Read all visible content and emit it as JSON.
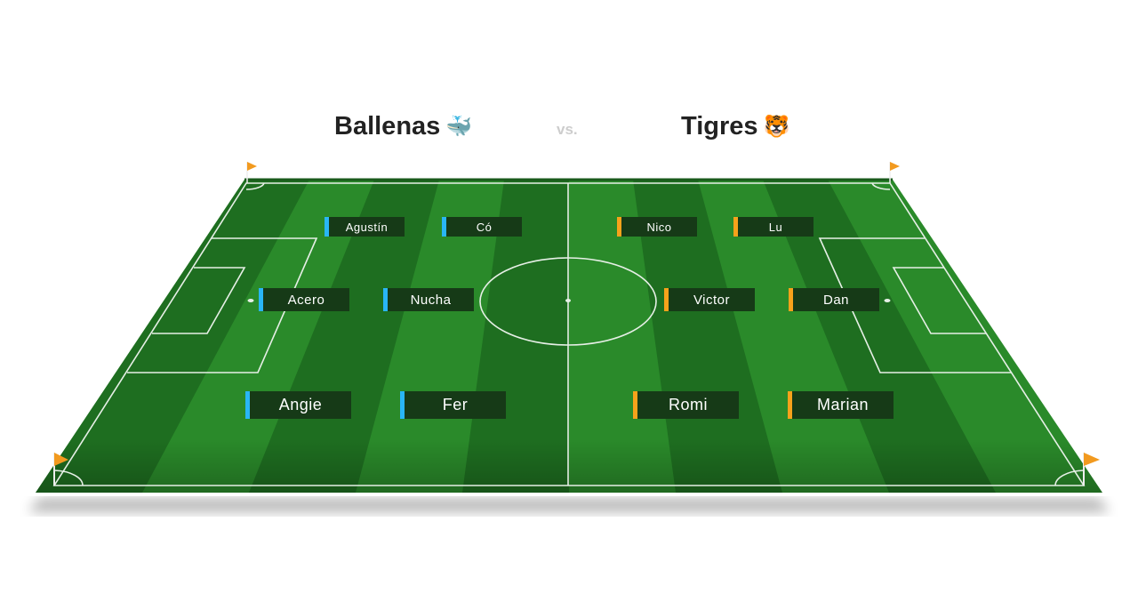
{
  "match": {
    "home": {
      "name": "Ballenas",
      "emoji": "🐳",
      "color": "#29b6f6"
    },
    "vs_label": "vs.",
    "away": {
      "name": "Tigres",
      "emoji": "🐯",
      "color": "#f7a21b"
    }
  },
  "pitch": {
    "grass_light": "#2a8a2a",
    "grass_dark": "#1e6e20",
    "line_color": "#e6efe6",
    "flag_color": "#f29a1f"
  },
  "players": {
    "home": [
      {
        "name": "Agustín"
      },
      {
        "name": "Có"
      },
      {
        "name": "Acero"
      },
      {
        "name": "Nucha"
      },
      {
        "name": "Angie"
      },
      {
        "name": "Fer"
      }
    ],
    "away": [
      {
        "name": "Nico"
      },
      {
        "name": "Lu"
      },
      {
        "name": "Victor"
      },
      {
        "name": "Dan"
      },
      {
        "name": "Romi"
      },
      {
        "name": "Marian"
      }
    ]
  }
}
